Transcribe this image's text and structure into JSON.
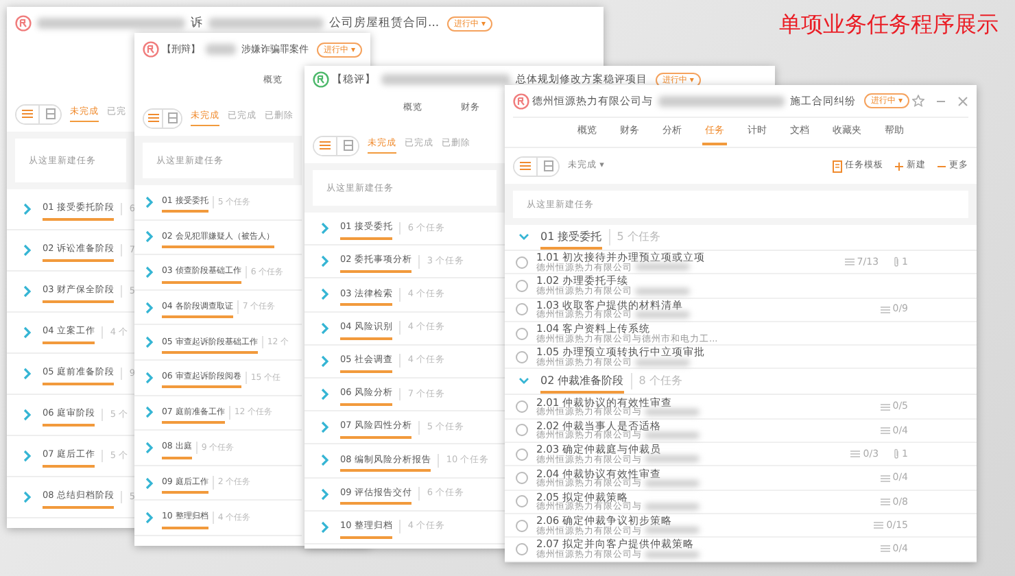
{
  "banner": "单项业务任务程序展示",
  "windows": [
    {
      "kind": "stage_list",
      "color": "#f07c7c",
      "title": [
        {
          "kind": "blur"
        },
        {
          "kind": "text",
          "text": "诉"
        },
        {
          "kind": "blur"
        },
        {
          "kind": "text",
          "text": "公司房屋租赁合同..."
        }
      ],
      "status": "进行中 ▾",
      "views": [
        {
          "kind": "list",
          "selected": true
        },
        {
          "kind": "grid",
          "selected": false
        }
      ],
      "filters": [
        {
          "label": "未完成",
          "selected": true
        },
        {
          "label": "已完",
          "selected": false
        }
      ],
      "new_task": {
        "placeholder": "从这里新建任务"
      },
      "stages": [
        {
          "name": "01 接受委托阶段",
          "count": "6",
          "expanded": false
        },
        {
          "name": "02 诉讼准备阶段",
          "count": "7",
          "expanded": false
        },
        {
          "name": "03 财产保全阶段",
          "count": "5",
          "expanded": false
        },
        {
          "name": "04 立案工作",
          "count": "4 个",
          "expanded": false
        },
        {
          "name": "05 庭前准备阶段",
          "count": "9",
          "expanded": false
        },
        {
          "name": "06 庭审阶段",
          "count": "5 个",
          "expanded": false
        },
        {
          "name": "07 庭后工作",
          "count": "5 个",
          "expanded": false
        },
        {
          "name": "08 总结归档阶段",
          "count": "5",
          "expanded": false
        }
      ]
    },
    {
      "kind": "stage_list",
      "color": "#f07c7c",
      "title": [
        {
          "kind": "text",
          "text": "【刑辩】"
        },
        {
          "kind": "blur"
        },
        {
          "kind": "text",
          "text": "涉嫌诈骗罪案件"
        }
      ],
      "status": "进行中 ▾",
      "tabs": [
        {
          "label": "概览",
          "selected": false
        }
      ],
      "views": [
        {
          "kind": "list",
          "selected": true
        },
        {
          "kind": "grid",
          "selected": false
        }
      ],
      "filters": [
        {
          "label": "未完成",
          "selected": true
        },
        {
          "label": "已完成",
          "selected": false
        },
        {
          "label": "已删除",
          "selected": false
        }
      ],
      "new_task": {
        "placeholder": "从这里新建任务"
      },
      "stages": [
        {
          "name": "01 接受委托",
          "count": "5 个任务",
          "expanded": false
        },
        {
          "name": "02 会见犯罪嫌疑人（被告人）",
          "expanded": false
        },
        {
          "name": "03 侦查阶段基础工作",
          "count": "6 个任务",
          "expanded": false
        },
        {
          "name": "04 各阶段调查取证",
          "count": "7 个任务",
          "expanded": false
        },
        {
          "name": "05 审查起诉阶段基础工作",
          "count": "12 个",
          "expanded": false
        },
        {
          "name": "06 审查起诉阶段阅卷",
          "count": "15 个任",
          "expanded": false
        },
        {
          "name": "07 庭前准备工作",
          "count": "12 个任务",
          "expanded": false
        },
        {
          "name": "08 出庭",
          "count": "9 个任务",
          "expanded": false
        },
        {
          "name": "09 庭后工作",
          "count": "2 个任务",
          "expanded": false
        },
        {
          "name": "10 整理归档",
          "count": "4 个任务",
          "expanded": false
        }
      ]
    },
    {
      "kind": "stage_list",
      "color": "#4cb86a",
      "title": [
        {
          "kind": "text",
          "text": "【稳评】"
        },
        {
          "kind": "blur"
        },
        {
          "kind": "text",
          "text": "总体规划修改方案稳评项目"
        }
      ],
      "status": "进行中 ▾",
      "tabs": [
        {
          "label": "概览",
          "selected": false
        },
        {
          "label": "财务",
          "selected": false
        }
      ],
      "views": [
        {
          "kind": "list",
          "selected": true
        },
        {
          "kind": "grid",
          "selected": false
        }
      ],
      "filters": [
        {
          "label": "未完成",
          "selected": true
        },
        {
          "label": "已完成",
          "selected": false
        },
        {
          "label": "已删除",
          "selected": false
        }
      ],
      "new_task": {
        "placeholder": "从这里新建任务"
      },
      "stages": [
        {
          "name": "01 接受委托",
          "count": "6 个任务",
          "expanded": false
        },
        {
          "name": "02 委托事项分析",
          "count": "3 个任务",
          "expanded": false
        },
        {
          "name": "03 法律检索",
          "count": "4 个任务",
          "expanded": false
        },
        {
          "name": "04 风险识别",
          "count": "4 个任务",
          "expanded": false
        },
        {
          "name": "05 社会调查",
          "count": "4 个任务",
          "expanded": false
        },
        {
          "name": "06 风险分析",
          "count": "7 个任务",
          "expanded": false
        },
        {
          "name": "07 风险四性分析",
          "count": "5 个任务",
          "expanded": false
        },
        {
          "name": "08 编制风险分析报告",
          "count": "10 个任务",
          "expanded": false
        },
        {
          "name": "09 评估报告交付",
          "count": "6 个任务",
          "expanded": false
        },
        {
          "name": "10 整理归档",
          "count": "4 个任务",
          "expanded": false
        }
      ]
    },
    {
      "kind": "task_detail",
      "color": "#f07c7c",
      "title": [
        {
          "kind": "text",
          "text": "德州恒源热力有限公司与"
        },
        {
          "kind": "blur"
        },
        {
          "kind": "text",
          "text": "施工合同纠纷"
        }
      ],
      "status": "进行中 ▾",
      "tabs": [
        {
          "label": "概览",
          "selected": false
        },
        {
          "label": "财务",
          "selected": false
        },
        {
          "label": "分析",
          "selected": false
        },
        {
          "label": "任务",
          "selected": true
        },
        {
          "label": "计时",
          "selected": false
        },
        {
          "label": "文档",
          "selected": false
        },
        {
          "label": "收藏夹",
          "selected": false
        },
        {
          "label": "帮助",
          "selected": false
        }
      ],
      "views": [
        {
          "kind": "list",
          "selected": true
        },
        {
          "kind": "grid",
          "selected": false
        }
      ],
      "status_filter": "未完成 ▾",
      "actions": [
        {
          "kind": "template",
          "label": "任务模板"
        },
        {
          "kind": "new",
          "label": "新建"
        },
        {
          "kind": "more",
          "label": "更多"
        }
      ],
      "new_task": {
        "placeholder": "从这里新建任务"
      },
      "sections": [
        {
          "name": "01 接受委托",
          "count": "5 个任务",
          "expanded": true,
          "tasks": [
            {
              "title": "1.01 初次接待并办理预立项或立项",
              "done": false,
              "client": [
                {
                  "kind": "text",
                  "text": "德州恒源热力有限公司"
                },
                {
                  "kind": "blur"
                }
              ],
              "checklist": "7/13",
              "attachments": "1"
            },
            {
              "title": "1.02 办理委托手续",
              "done": false,
              "client": [
                {
                  "kind": "text",
                  "text": "德州恒源热力有限公司"
                },
                {
                  "kind": "blur"
                }
              ]
            },
            {
              "title": "1.03 收取客户提供的材料清单",
              "done": false,
              "client": [
                {
                  "kind": "text",
                  "text": "德州恒源热力有限公司"
                },
                {
                  "kind": "blur"
                }
              ],
              "checklist": "0/9"
            },
            {
              "title": "1.04 客户资料上传系统",
              "done": false,
              "client": [
                {
                  "kind": "text",
                  "text": "德州恒源热力有限公司与德州市和电力工..."
                }
              ]
            },
            {
              "title": "1.05 办理预立项转执行中立项审批",
              "done": false,
              "client": [
                {
                  "kind": "text",
                  "text": "德州恒源热力有限公司"
                },
                {
                  "kind": "blur"
                }
              ]
            }
          ]
        },
        {
          "name": "02 仲裁准备阶段",
          "count": "8 个任务",
          "expanded": true,
          "tasks": [
            {
              "title": "2.01 仲裁协议的有效性审查",
              "done": false,
              "client": [
                {
                  "kind": "text",
                  "text": "德州恒源热力有限公司与"
                },
                {
                  "kind": "blur"
                }
              ],
              "checklist": "0/5"
            },
            {
              "title": "2.02 仲裁当事人是否适格",
              "done": false,
              "client": [
                {
                  "kind": "text",
                  "text": "德州恒源热力有限公司与"
                },
                {
                  "kind": "blur"
                }
              ],
              "checklist": "0/4"
            },
            {
              "title": "2.03 确定仲裁庭与仲裁员",
              "done": false,
              "client": [
                {
                  "kind": "text",
                  "text": "德州恒源热力有限公司与"
                },
                {
                  "kind": "blur"
                }
              ],
              "checklist": "0/3",
              "attachments": "1"
            },
            {
              "title": "2.04 仲裁协议有效性审查",
              "done": false,
              "client": [
                {
                  "kind": "text",
                  "text": "德州恒源热力有限公司与"
                },
                {
                  "kind": "blur"
                }
              ],
              "checklist": "0/4"
            },
            {
              "title": "2.05 拟定仲裁策略",
              "done": false,
              "client": [
                {
                  "kind": "text",
                  "text": "德州恒源热力有限公司与"
                },
                {
                  "kind": "blur"
                }
              ],
              "checklist": "0/8"
            },
            {
              "title": "2.06 确定仲裁争议初步策略",
              "done": false,
              "client": [
                {
                  "kind": "text",
                  "text": "德州恒源热力有限公司与"
                },
                {
                  "kind": "blur"
                }
              ],
              "checklist": "0/15"
            },
            {
              "title": "2.07 拟定并向客户提供仲裁策略",
              "done": false,
              "client": [
                {
                  "kind": "text",
                  "text": "德州恒源热力有限公司与"
                },
                {
                  "kind": "blur"
                }
              ],
              "checklist": "0/4"
            }
          ]
        }
      ]
    }
  ]
}
